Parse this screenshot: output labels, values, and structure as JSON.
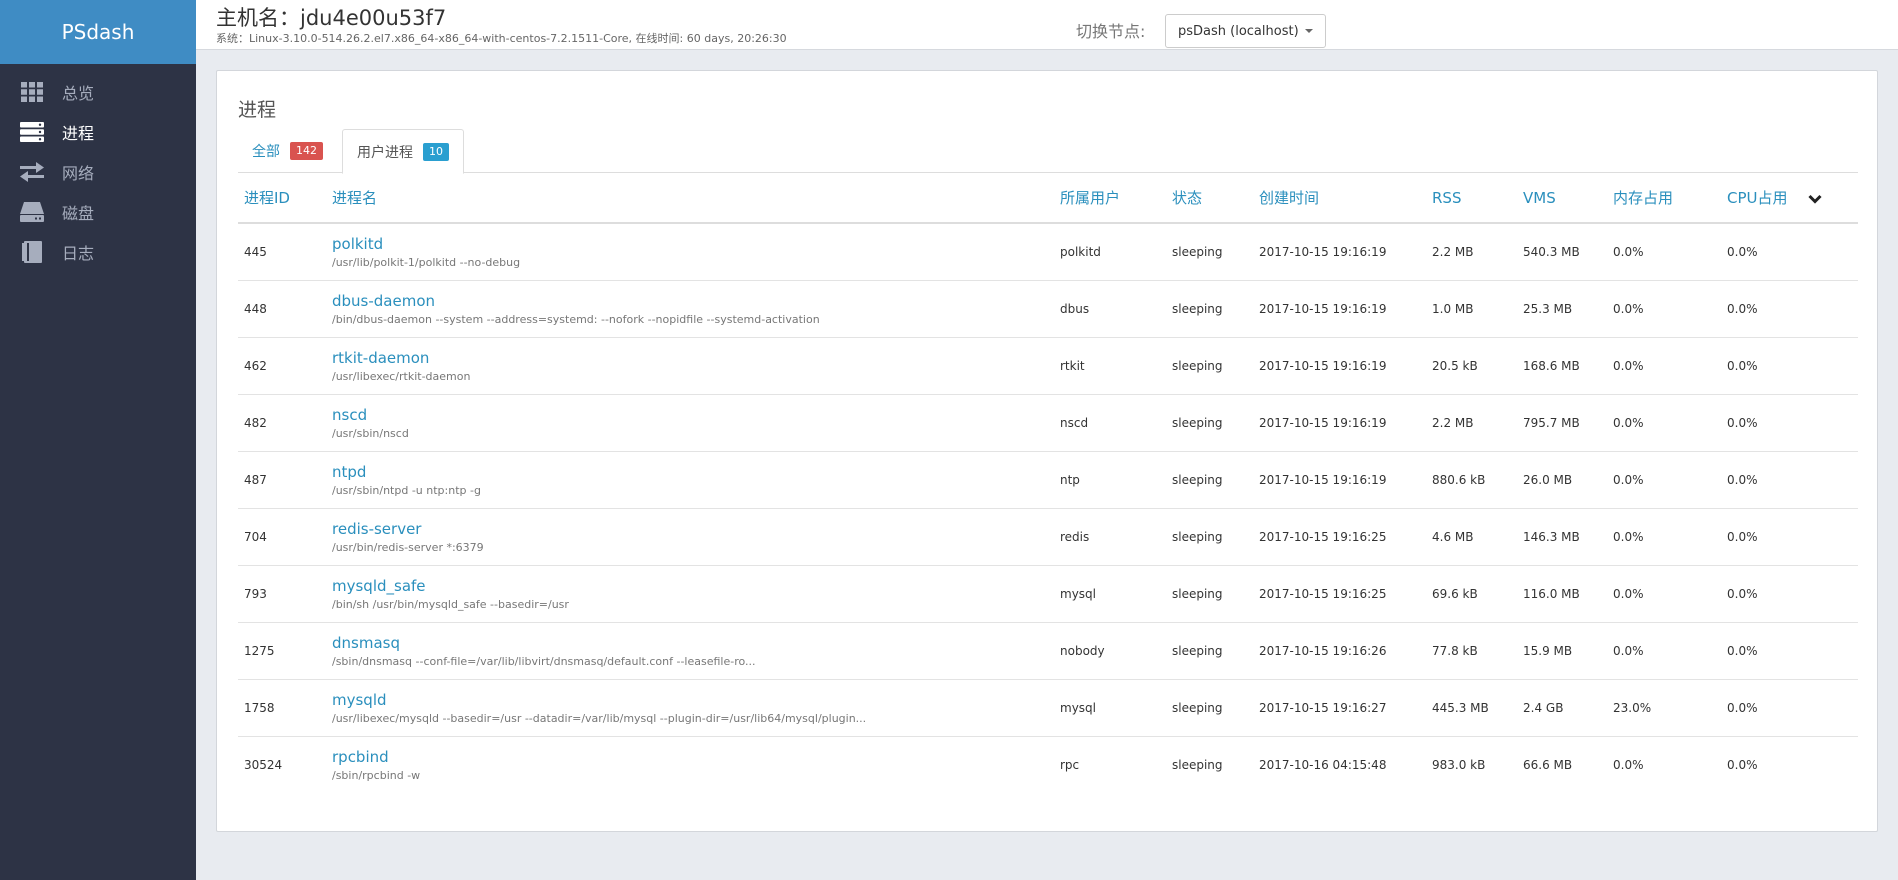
{
  "brand": "PSdash",
  "sidebar": {
    "items": [
      {
        "label": "总览",
        "icon": "grid-icon"
      },
      {
        "label": "进程",
        "icon": "server-list-icon"
      },
      {
        "label": "网络",
        "icon": "exchange-arrows-icon"
      },
      {
        "label": "磁盘",
        "icon": "hdd-icon"
      },
      {
        "label": "日志",
        "icon": "book-icon"
      }
    ],
    "active_index": 1
  },
  "header": {
    "host_title": "主机名：jdu4e00u53f7",
    "system_info": "系统：Linux-3.10.0-514.26.2.el7.x86_64-x86_64-with-centos-7.2.1511-Core, 在线时间: 60 days, 20:26:30",
    "node_label": "切换节点:",
    "node_selected": "psDash (localhost)"
  },
  "panel": {
    "title": "进程",
    "tabs": [
      {
        "label": "全部",
        "count": "142",
        "color": "#d9534f"
      },
      {
        "label": "用户进程",
        "count": "10",
        "color": "#2a9fd0"
      }
    ],
    "active_tab": 1
  },
  "table": {
    "columns": [
      "进程ID",
      "进程名",
      "所属用户",
      "状态",
      "创建时间",
      "RSS",
      "VMS",
      "内存占用",
      "CPU占用"
    ],
    "rows": [
      {
        "pid": "445",
        "name": "polkitd",
        "cmd": "/usr/lib/polkit-1/polkitd --no-debug",
        "user": "polkitd",
        "status": "sleeping",
        "created": "2017-10-15 19:16:19",
        "rss": "2.2 MB",
        "vms": "540.3 MB",
        "mem": "0.0%",
        "cpu": "0.0%"
      },
      {
        "pid": "448",
        "name": "dbus-daemon",
        "cmd": "/bin/dbus-daemon --system --address=systemd: --nofork --nopidfile --systemd-activation",
        "user": "dbus",
        "status": "sleeping",
        "created": "2017-10-15 19:16:19",
        "rss": "1.0 MB",
        "vms": "25.3 MB",
        "mem": "0.0%",
        "cpu": "0.0%"
      },
      {
        "pid": "462",
        "name": "rtkit-daemon",
        "cmd": "/usr/libexec/rtkit-daemon",
        "user": "rtkit",
        "status": "sleeping",
        "created": "2017-10-15 19:16:19",
        "rss": "20.5 kB",
        "vms": "168.6 MB",
        "mem": "0.0%",
        "cpu": "0.0%"
      },
      {
        "pid": "482",
        "name": "nscd",
        "cmd": "/usr/sbin/nscd",
        "user": "nscd",
        "status": "sleeping",
        "created": "2017-10-15 19:16:19",
        "rss": "2.2 MB",
        "vms": "795.7 MB",
        "mem": "0.0%",
        "cpu": "0.0%"
      },
      {
        "pid": "487",
        "name": "ntpd",
        "cmd": "/usr/sbin/ntpd -u ntp:ntp -g",
        "user": "ntp",
        "status": "sleeping",
        "created": "2017-10-15 19:16:19",
        "rss": "880.6 kB",
        "vms": "26.0 MB",
        "mem": "0.0%",
        "cpu": "0.0%"
      },
      {
        "pid": "704",
        "name": "redis-server",
        "cmd": "/usr/bin/redis-server *:6379",
        "user": "redis",
        "status": "sleeping",
        "created": "2017-10-15 19:16:25",
        "rss": "4.6 MB",
        "vms": "146.3 MB",
        "mem": "0.0%",
        "cpu": "0.0%"
      },
      {
        "pid": "793",
        "name": "mysqld_safe",
        "cmd": "/bin/sh /usr/bin/mysqld_safe --basedir=/usr",
        "user": "mysql",
        "status": "sleeping",
        "created": "2017-10-15 19:16:25",
        "rss": "69.6 kB",
        "vms": "116.0 MB",
        "mem": "0.0%",
        "cpu": "0.0%"
      },
      {
        "pid": "1275",
        "name": "dnsmasq",
        "cmd": "/sbin/dnsmasq --conf-file=/var/lib/libvirt/dnsmasq/default.conf --leasefile-ro...",
        "user": "nobody",
        "status": "sleeping",
        "created": "2017-10-15 19:16:26",
        "rss": "77.8 kB",
        "vms": "15.9 MB",
        "mem": "0.0%",
        "cpu": "0.0%"
      },
      {
        "pid": "1758",
        "name": "mysqld",
        "cmd": "/usr/libexec/mysqld --basedir=/usr --datadir=/var/lib/mysql --plugin-dir=/usr/lib64/mysql/plugin...",
        "user": "mysql",
        "status": "sleeping",
        "created": "2017-10-15 19:16:27",
        "rss": "445.3 MB",
        "vms": "2.4 GB",
        "mem": "23.0%",
        "cpu": "0.0%"
      },
      {
        "pid": "30524",
        "name": "rpcbind",
        "cmd": "/sbin/rpcbind -w",
        "user": "rpc",
        "status": "sleeping",
        "created": "2017-10-16 04:15:48",
        "rss": "983.0 kB",
        "vms": "66.6 MB",
        "mem": "0.0%",
        "cpu": "0.0%"
      }
    ]
  }
}
